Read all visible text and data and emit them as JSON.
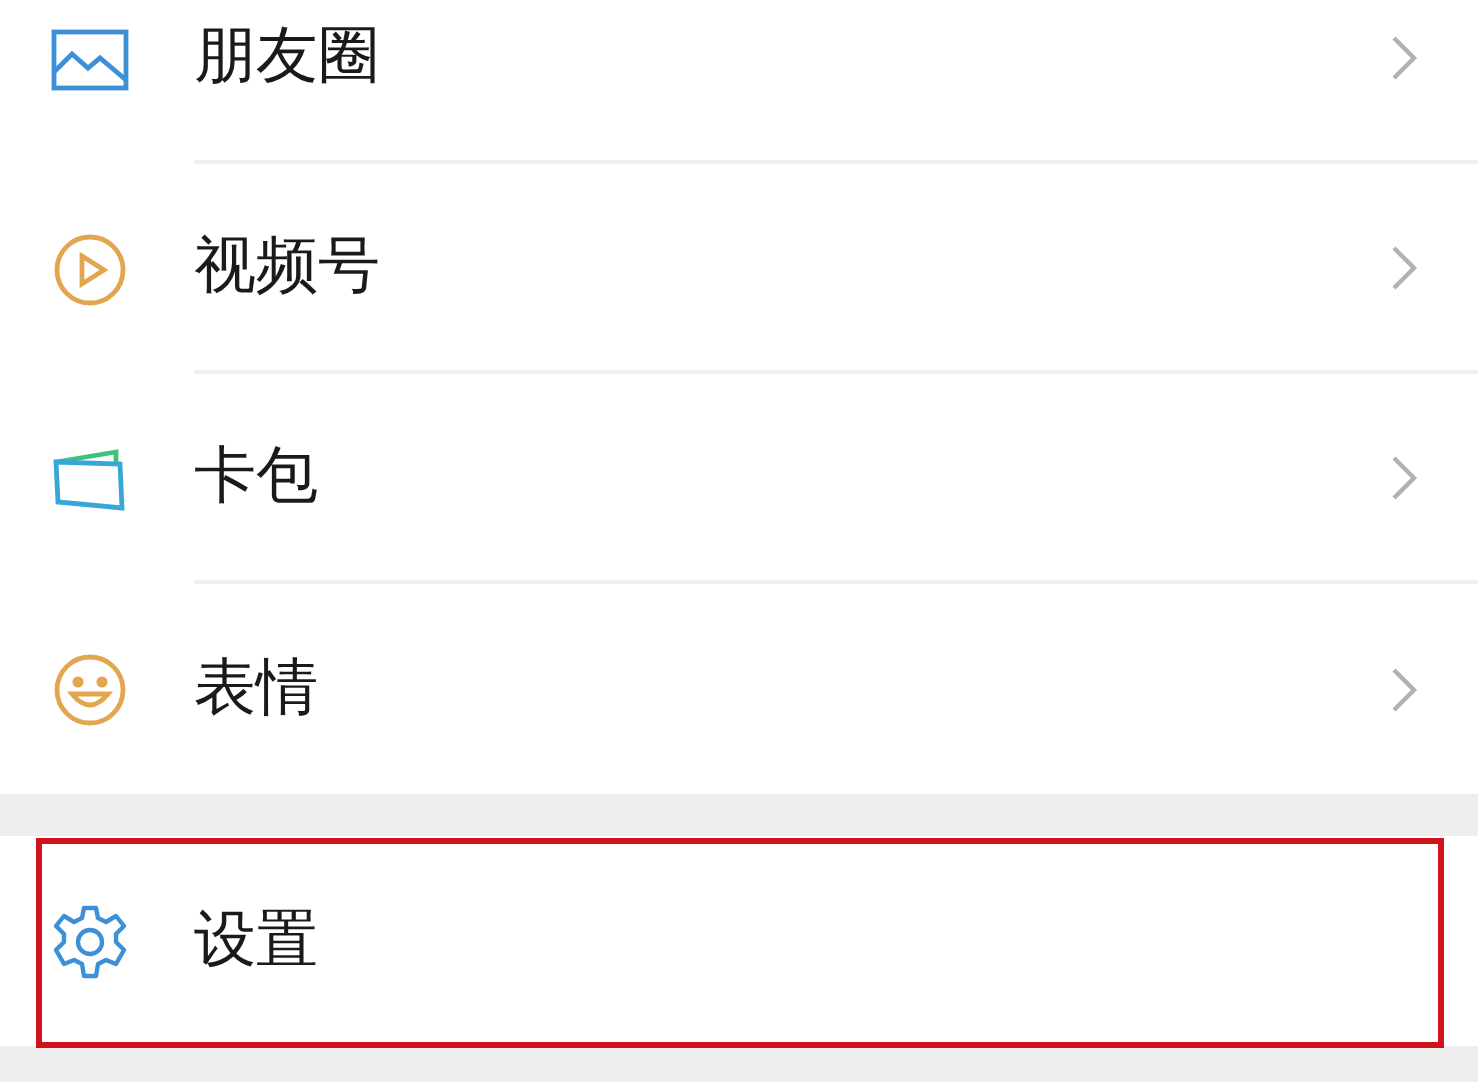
{
  "groups": [
    {
      "items": [
        {
          "label": "朋友圈",
          "chevron": true,
          "highlighted": false
        },
        {
          "label": "视频号",
          "chevron": true,
          "highlighted": false
        },
        {
          "label": "卡包",
          "chevron": true,
          "highlighted": false
        },
        {
          "label": "表情",
          "chevron": true,
          "highlighted": false
        }
      ]
    },
    {
      "items": [
        {
          "label": "设置",
          "chevron": false,
          "highlighted": true
        }
      ]
    }
  ]
}
